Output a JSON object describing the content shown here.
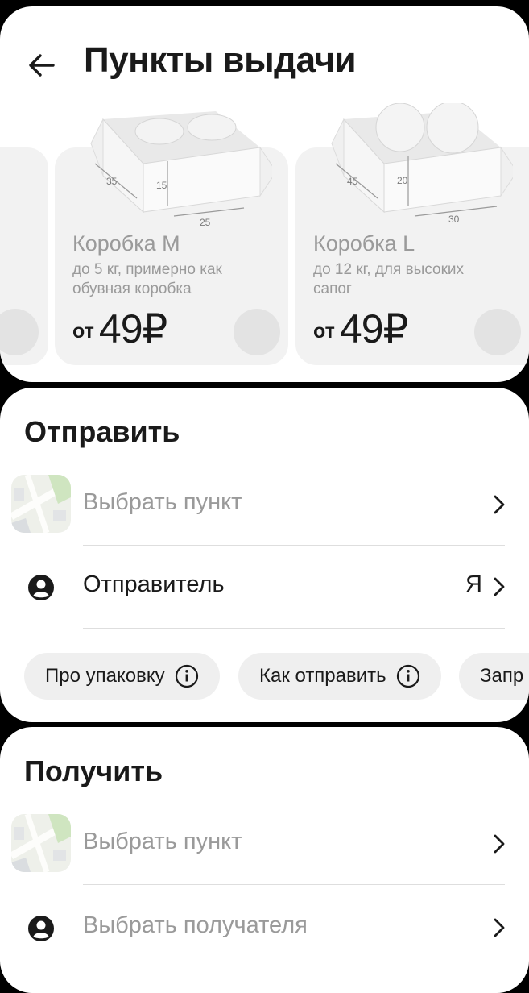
{
  "header": {
    "title": "Пункты выдачи",
    "back_icon": "arrow-left-icon"
  },
  "boxes": [
    {
      "id": "s",
      "name": "",
      "description": "",
      "price_from": "",
      "price": "",
      "dims": []
    },
    {
      "id": "m",
      "name": "Коробка M",
      "description": "до 5 кг, примерно как обувная коробка",
      "price_from": "от",
      "price": "49₽",
      "dims": [
        "35",
        "15",
        "25"
      ]
    },
    {
      "id": "l",
      "name": "Коробка L",
      "description": "до 12 кг, для высоких сапог",
      "price_from": "от",
      "price": "49₽",
      "dims": [
        "45",
        "20",
        "30"
      ]
    }
  ],
  "send": {
    "title": "Отправить",
    "pickup_point_placeholder": "Выбрать пункт",
    "sender_label": "Отправитель",
    "sender_value": "Я",
    "chips": [
      {
        "label": "Про упаковку"
      },
      {
        "label": "Как отправить"
      },
      {
        "label": "Запр"
      }
    ]
  },
  "receive": {
    "title": "Получить",
    "pickup_point_placeholder": "Выбрать пункт",
    "recipient_placeholder": "Выбрать получателя"
  },
  "colors": {
    "background": "#000000",
    "card": "#ffffff",
    "tile": "#f2f2f2",
    "muted_text": "#9a9a9a",
    "chip": "#efefef"
  }
}
